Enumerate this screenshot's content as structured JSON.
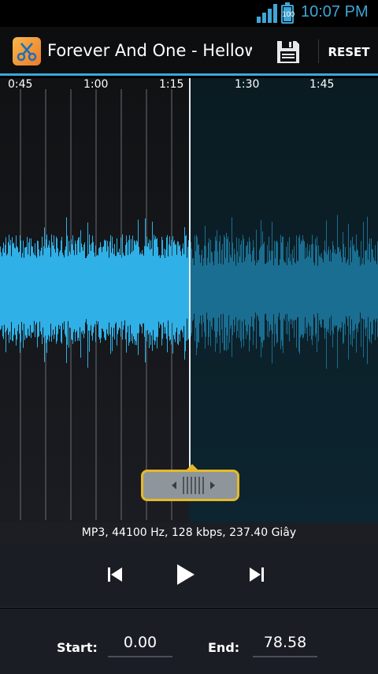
{
  "status_bar": {
    "time": "10:07 PM",
    "battery_level": "100",
    "accent_color": "#3fa6d6"
  },
  "action_bar": {
    "app_icon": "scissors-app-icon",
    "title": "Forever And One - Helloween",
    "save_icon": "floppy-disk-icon",
    "reset_label": "RESET",
    "accent_color": "#39a8dc"
  },
  "timeline": {
    "tick_labels": [
      "0:45",
      "1:00",
      "1:15",
      "1:30",
      "1:45"
    ]
  },
  "waveform": {
    "selected_color": "#2fb0e6",
    "unselected_color": "#1a6e91"
  },
  "info": {
    "text": "MP3, 44100 Hz, 128 kbps, 237.40 Giây"
  },
  "controls": {
    "previous_icon": "skip-previous-icon",
    "play_icon": "play-icon",
    "next_icon": "skip-next-icon"
  },
  "range": {
    "start_label": "Start:",
    "start_value": "0.00",
    "end_label": "End:",
    "end_value": "78.58"
  }
}
